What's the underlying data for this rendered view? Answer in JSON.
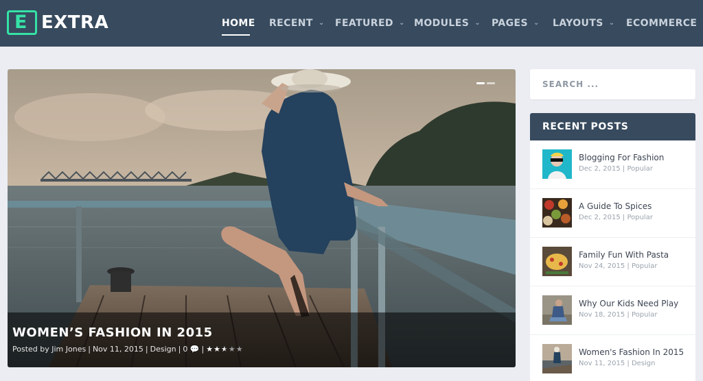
{
  "header": {
    "logo_mark": "E",
    "logo_text": "EXTRA",
    "nav": [
      {
        "label": "HOME",
        "dropdown": false,
        "active": true
      },
      {
        "label": "RECENT",
        "dropdown": true
      },
      {
        "label": "FEATURED",
        "dropdown": true
      },
      {
        "label": "MODULES",
        "dropdown": true
      },
      {
        "label": "PAGES",
        "dropdown": true
      },
      {
        "label": "LAYOUTS",
        "dropdown": true
      },
      {
        "label": "ECOMMERCE",
        "dropdown": false
      }
    ]
  },
  "hero": {
    "title": "WOMEN’S FASHION IN 2015",
    "meta": {
      "posted_by": "Posted by Jim Jones",
      "date": "Nov 11, 2015",
      "category": "Design",
      "comments": "0",
      "rating": 2.5,
      "rating_max": 5
    }
  },
  "search": {
    "placeholder": "SEARCH ..."
  },
  "recent_posts": {
    "heading": "RECENT POSTS",
    "items": [
      {
        "title": "Blogging For Fashion",
        "date": "Dec 2, 2015",
        "category": "Popular"
      },
      {
        "title": "A Guide To Spices",
        "date": "Dec 2, 2015",
        "category": "Popular"
      },
      {
        "title": "Family Fun With Pasta",
        "date": "Nov 24, 2015",
        "category": "Popular"
      },
      {
        "title": "Why Our Kids Need Play",
        "date": "Nov 18, 2015",
        "category": "Popular"
      },
      {
        "title": "Women's Fashion In 2015",
        "date": "Nov 11, 2015",
        "category": "Design"
      }
    ]
  },
  "colors": {
    "header_bg": "#374a5e",
    "accent": "#35e3a6",
    "page_bg": "#ebedf2"
  }
}
